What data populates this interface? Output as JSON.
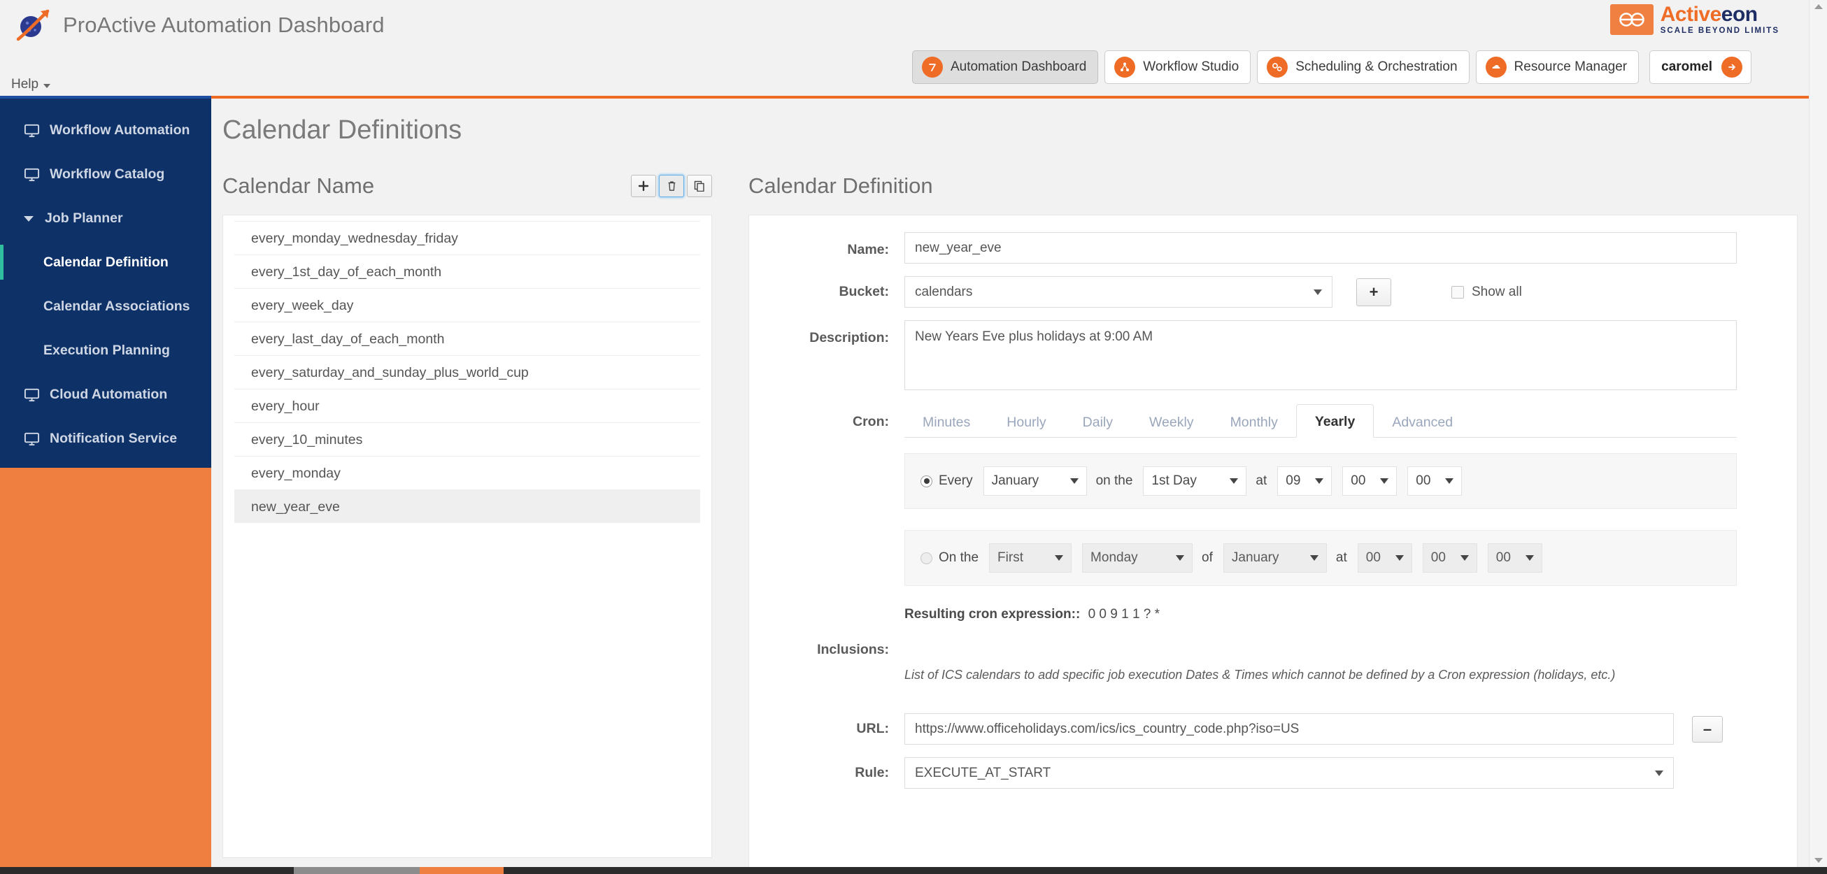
{
  "app": {
    "title": "ProActive Automation Dashboard",
    "logo_icon": "proactive-planet-icon",
    "vendor_name_part1": "Active",
    "vendor_name_part2": "eon",
    "vendor_tagline": "SCALE BEYOND LIMITS"
  },
  "menubar": {
    "help_label": "Help",
    "help_caret_icon": "chevron-down-icon"
  },
  "apptabs": [
    {
      "label": "Automation Dashboard",
      "icon": "speedometer-icon",
      "active": true
    },
    {
      "label": "Workflow Studio",
      "icon": "workflow-nodes-icon",
      "active": false
    },
    {
      "label": "Scheduling & Orchestration",
      "icon": "gears-icon",
      "active": false
    },
    {
      "label": "Resource Manager",
      "icon": "cloud-icon",
      "active": false
    }
  ],
  "user": {
    "name": "caromel",
    "logout_icon": "logout-arrow-icon"
  },
  "sidebar": {
    "items": [
      {
        "label": "Workflow Automation",
        "icon": "monitor-icon",
        "level": "top",
        "active": false
      },
      {
        "label": "Workflow Catalog",
        "icon": "monitor-icon",
        "level": "top",
        "active": false
      },
      {
        "label": "Job Planner",
        "icon": "chevron-down-icon",
        "level": "top",
        "expanded": true,
        "active": false
      },
      {
        "label": "Calendar Definition",
        "icon": "",
        "level": "sub",
        "active": true
      },
      {
        "label": "Calendar Associations",
        "icon": "",
        "level": "sub",
        "active": false
      },
      {
        "label": "Execution Planning",
        "icon": "",
        "level": "sub",
        "active": false
      },
      {
        "label": "Cloud Automation",
        "icon": "monitor-icon",
        "level": "top",
        "active": false
      },
      {
        "label": "Notification Service",
        "icon": "monitor-icon",
        "level": "top",
        "active": false
      }
    ]
  },
  "main": {
    "page_title": "Calendar Definitions"
  },
  "calendar_list": {
    "header": "Calendar Name",
    "tools": [
      {
        "name": "add-calendar-button",
        "icon": "plus-icon",
        "focused": false
      },
      {
        "name": "delete-calendar-button",
        "icon": "trash-icon",
        "focused": true
      },
      {
        "name": "duplicate-calendar-button",
        "icon": "copy-icon",
        "focused": false
      }
    ],
    "items": [
      {
        "label": "every_monday_wednesday_friday",
        "selected": false
      },
      {
        "label": "every_1st_day_of_each_month",
        "selected": false
      },
      {
        "label": "every_week_day",
        "selected": false
      },
      {
        "label": "every_last_day_of_each_month",
        "selected": false
      },
      {
        "label": "every_saturday_and_sunday_plus_world_cup",
        "selected": false
      },
      {
        "label": "every_hour",
        "selected": false
      },
      {
        "label": "every_10_minutes",
        "selected": false
      },
      {
        "label": "every_monday",
        "selected": false
      },
      {
        "label": "new_year_eve",
        "selected": true
      }
    ]
  },
  "definition": {
    "header": "Calendar Definition",
    "name_label": "Name:",
    "name_value": "new_year_eve",
    "bucket_label": "Bucket:",
    "bucket_value": "calendars",
    "bucket_add_label": "+",
    "show_all_label": "Show all",
    "show_all_checked": false,
    "description_label": "Description:",
    "description_value": "New Years Eve plus holidays at 9:00 AM",
    "cron_label": "Cron:",
    "cron_tabs": [
      {
        "label": "Minutes",
        "active": false
      },
      {
        "label": "Hourly",
        "active": false
      },
      {
        "label": "Daily",
        "active": false
      },
      {
        "label": "Weekly",
        "active": false
      },
      {
        "label": "Monthly",
        "active": false
      },
      {
        "label": "Yearly",
        "active": true
      },
      {
        "label": "Advanced",
        "active": false
      }
    ],
    "every_row": {
      "selected": true,
      "prefix_label": "Every",
      "month_value": "January",
      "onthe_label": "on the",
      "day_value": "1st Day",
      "at_label": "at",
      "hour_value": "09",
      "minute_value": "00",
      "second_value": "00"
    },
    "onthe_row": {
      "selected": false,
      "prefix_label": "On the",
      "ordinal_value": "First",
      "weekday_value": "Monday",
      "of_label": "of",
      "month_value": "January",
      "at_label": "at",
      "hour_value": "00",
      "minute_value": "00",
      "second_value": "00"
    },
    "cron_expression_label": "Resulting cron expression::",
    "cron_expression_value": "0 0 9 1 1 ? *",
    "inclusions_label": "Inclusions:",
    "inclusions_help": "List of ICS calendars to add specific job execution Dates & Times which cannot be defined by a Cron expression (holidays, etc.)",
    "url_label": "URL:",
    "url_value": "https://www.officeholidays.com/ics/ics_country_code.php?iso=US",
    "remove_inclusion_label": "–",
    "rule_label": "Rule:",
    "rule_value": "EXECUTE_AT_START"
  },
  "colors": {
    "brand_orange": "#ef6c27",
    "sidebar_navy": "#0e3268",
    "sidebar_orange": "#ef7f40",
    "accent_green": "#2fbfa0",
    "focus_blue": "#66afe9"
  }
}
